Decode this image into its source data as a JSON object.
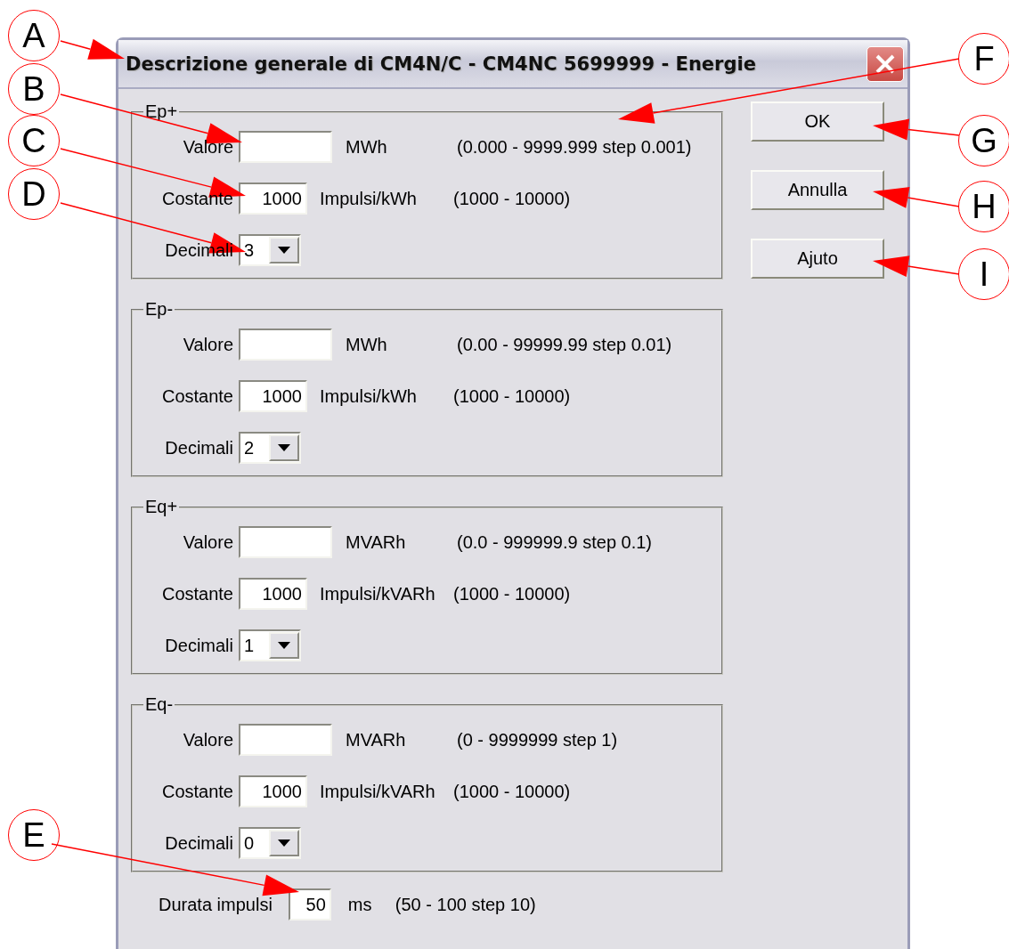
{
  "window": {
    "title": "Descrizione generale di CM4N/C - CM4NC 5699999 - Energie"
  },
  "groups": [
    {
      "label": "Ep+",
      "valore": {
        "label": "Valore",
        "unit": "MWh",
        "range": "(0.000 - 9999.999 step 0.001)"
      },
      "costante": {
        "label": "Costante",
        "value": "1000",
        "unit": "Impulsi/kWh",
        "range": "(1000 - 10000)"
      },
      "decimali": {
        "label": "Decimali",
        "value": "3"
      }
    },
    {
      "label": "Ep-",
      "valore": {
        "label": "Valore",
        "unit": "MWh",
        "range": "(0.00 - 99999.99 step 0.01)"
      },
      "costante": {
        "label": "Costante",
        "value": "1000",
        "unit": "Impulsi/kWh",
        "range": "(1000 - 10000)"
      },
      "decimali": {
        "label": "Decimali",
        "value": "2"
      }
    },
    {
      "label": "Eq+",
      "valore": {
        "label": "Valore",
        "unit": "MVARh",
        "range": "(0.0 - 999999.9 step 0.1)"
      },
      "costante": {
        "label": "Costante",
        "value": "1000",
        "unit": "Impulsi/kVARh",
        "range": "(1000 - 10000)"
      },
      "decimali": {
        "label": "Decimali",
        "value": "1"
      }
    },
    {
      "label": "Eq-",
      "valore": {
        "label": "Valore",
        "unit": "MVARh",
        "range": "(0 - 9999999 step 1)"
      },
      "costante": {
        "label": "Costante",
        "value": "1000",
        "unit": "Impulsi/kVARh",
        "range": "(1000 - 10000)"
      },
      "decimali": {
        "label": "Decimali",
        "value": "0"
      }
    }
  ],
  "pulse_duration": {
    "label": "Durata impulsi",
    "value": "50",
    "unit": "ms",
    "range": "(50 - 100 step 10)"
  },
  "buttons": [
    "OK",
    "Annulla",
    "Ajuto"
  ],
  "callouts": [
    {
      "letter": "A"
    },
    {
      "letter": "B"
    },
    {
      "letter": "C"
    },
    {
      "letter": "D"
    },
    {
      "letter": "E"
    },
    {
      "letter": "F"
    },
    {
      "letter": "G"
    },
    {
      "letter": "H"
    },
    {
      "letter": "I"
    }
  ]
}
